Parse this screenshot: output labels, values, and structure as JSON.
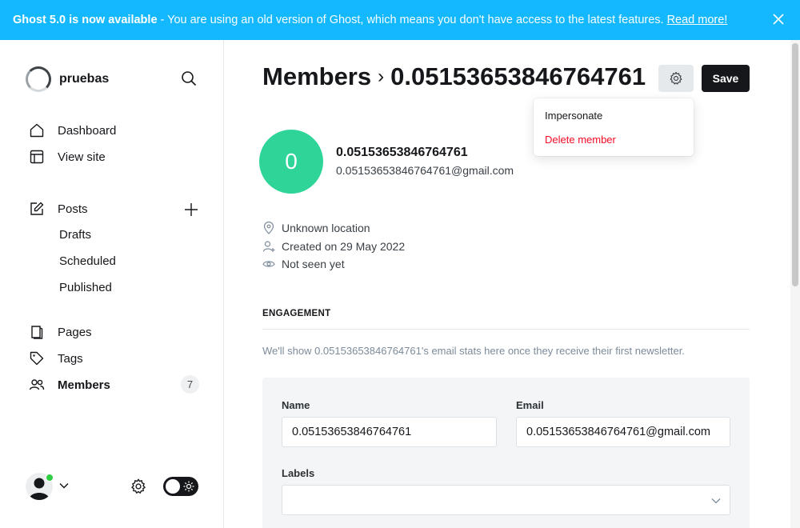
{
  "banner": {
    "headline": "Ghost 5.0 is now available",
    "message": "- You are using an old version of Ghost, which means you don't have access to the latest features.",
    "link": "Read more!"
  },
  "sidebar": {
    "site_name": "pruebas",
    "nav": [
      {
        "label": "Dashboard",
        "icon": "home-icon"
      },
      {
        "label": "View site",
        "icon": "layout-icon"
      },
      {
        "label": "Posts",
        "icon": "edit-icon"
      },
      {
        "label": "Drafts"
      },
      {
        "label": "Scheduled"
      },
      {
        "label": "Published"
      },
      {
        "label": "Pages",
        "icon": "pages-icon"
      },
      {
        "label": "Tags",
        "icon": "tag-icon"
      },
      {
        "label": "Members",
        "icon": "members-icon",
        "count": "7"
      }
    ]
  },
  "header": {
    "breadcrumb_root": "Members",
    "breadcrumb_current": "0.05153653846764761",
    "save_label": "Save"
  },
  "menu": {
    "impersonate": "Impersonate",
    "delete": "Delete member"
  },
  "member": {
    "initial": "0",
    "name": "0.05153653846764761",
    "email": "0.05153653846764761@gmail.com",
    "location": "Unknown location",
    "created": "Created on 29 May 2022",
    "seen": "Not seen yet"
  },
  "engagement": {
    "heading": "ENGAGEMENT",
    "text": "We'll show 0.05153653846764761's email stats here once they receive their first newsletter."
  },
  "form": {
    "name_label": "Name",
    "name_value": "0.05153653846764761",
    "email_label": "Email",
    "email_value": "0.05153653846764761@gmail.com",
    "labels_label": "Labels",
    "labels_value": ""
  },
  "colors": {
    "banner": "#14b8ff",
    "avatar": "#2fd598",
    "danger": "#f50b23"
  }
}
